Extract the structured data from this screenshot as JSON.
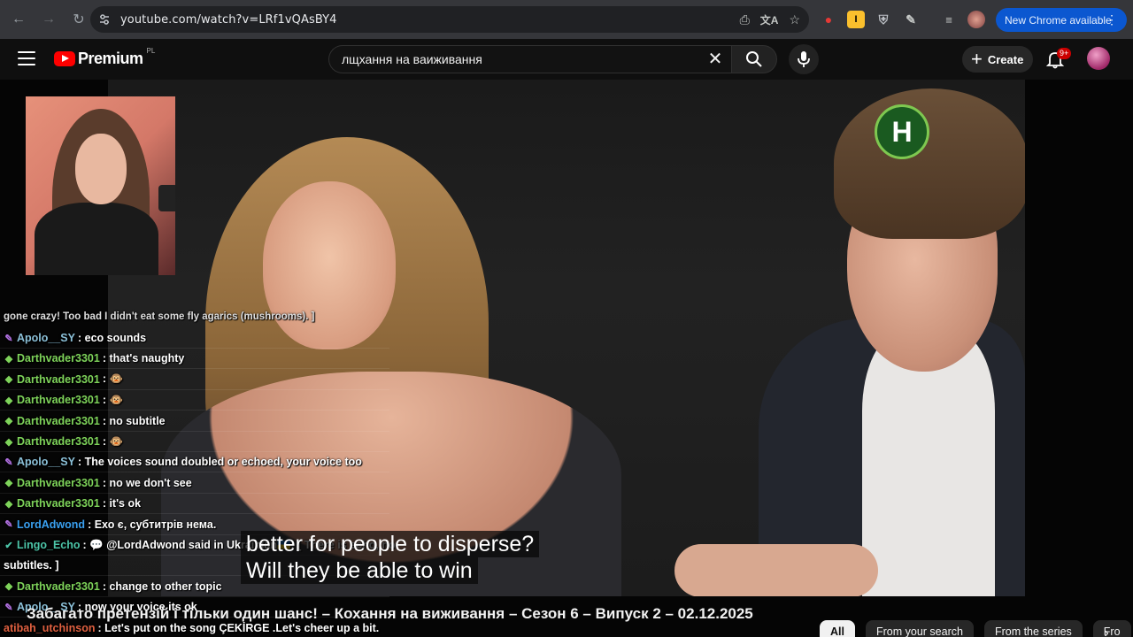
{
  "browser": {
    "url": "youtube.com/watch?v=LRf1vQAsBY4",
    "new_chrome_label": "New Chrome available"
  },
  "youtube": {
    "logo_text": "Premium",
    "country_code": "PL",
    "search_query": "лщхання на ваиживання",
    "create_label": "Create",
    "notification_count": "9+"
  },
  "video": {
    "channel_badge": "H",
    "title": "Забагато претензій і тільки один шанс! – Кохання на виживання – Сезон 6 – Випуск 2 – 02.12.2025",
    "subtitle_line1": "better for people to disperse?",
    "subtitle_line2": "Will they be able to win"
  },
  "chat": {
    "top_fragment": "gone crazy! Too bad I didn't eat some fly agarics (mushrooms). ]",
    "messages": [
      {
        "user": "Apolo__SY",
        "text": ": eco sounds",
        "color": "#8bc0d8",
        "badge": "brush"
      },
      {
        "user": "Darthvader3301",
        "text": ": that's naughty",
        "color": "#7ed35a",
        "badge": "diamond"
      },
      {
        "user": "Darthvader3301",
        "text": ": 🐵",
        "color": "#7ed35a",
        "badge": "diamond"
      },
      {
        "user": "Darthvader3301",
        "text": ": 🐵",
        "color": "#7ed35a",
        "badge": "diamond"
      },
      {
        "user": "Darthvader3301",
        "text": ": no subtitle",
        "color": "#7ed35a",
        "badge": "diamond"
      },
      {
        "user": "Darthvader3301",
        "text": ": 🐵",
        "color": "#7ed35a",
        "badge": "diamond"
      },
      {
        "user": "Apolo__SY",
        "text": ": The voices sound doubled or echoed, your voice too",
        "color": "#8bc0d8",
        "badge": "brush"
      },
      {
        "user": "Darthvader3301",
        "text": ": no we don't see",
        "color": "#7ed35a",
        "badge": "diamond"
      },
      {
        "user": "Darthvader3301",
        "text": ": it's ok",
        "color": "#7ed35a",
        "badge": "diamond"
      },
      {
        "user": "LordAdwond",
        "text": ": Ехо є, субтитрів нема.",
        "color": "#3aa0f0",
        "badge": "brush"
      },
      {
        "user": "Lingo_Echo",
        "text": ": 💬 @LordAdwond said in Ukrainian🇺🇦: [ There is echo, no",
        "color": "#4cc5a8",
        "badge": "check"
      },
      {
        "user": "",
        "text": "subtitles. ]",
        "color": "#fff",
        "badge": ""
      },
      {
        "user": "Darthvader3301",
        "text": ": change to other topic",
        "color": "#7ed35a",
        "badge": "diamond"
      },
      {
        "user": "Apolo__SY",
        "text": ": now your voice its ok",
        "color": "#8bc0d8",
        "badge": "brush"
      },
      {
        "user": "atibah_utchinson",
        "text": ": Let's put on the song ÇEKİRGE .Let's cheer up a bit.",
        "color": "#e06040",
        "badge": ""
      }
    ]
  },
  "chips": [
    "All",
    "From your search",
    "From the series",
    "Fro"
  ]
}
